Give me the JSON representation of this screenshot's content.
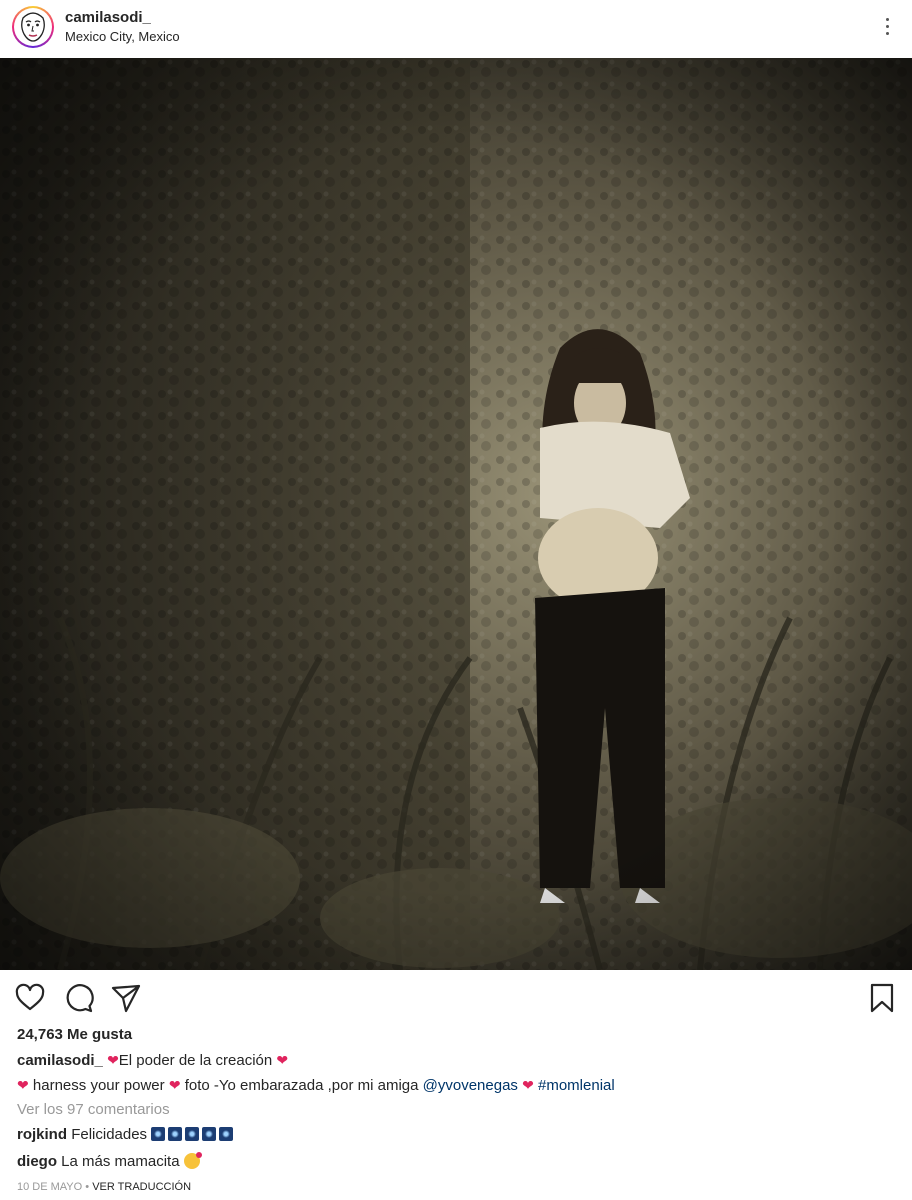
{
  "post": {
    "username": "camilasodi_",
    "location": "Mexico City, Mexico",
    "likes": "24,763 Me gusta",
    "caption": {
      "line1": "El poder de la creación",
      "line2_a": "harness your power",
      "line2_b": "foto -Yo embarazada ,por mi amiga",
      "mention": "@yvovenegas",
      "hashtag": "#momlenial",
      "heart": "❤"
    },
    "view_comments": "Ver los 97 comentarios",
    "comments": [
      {
        "user": "rojkind",
        "text": "Felicidades"
      },
      {
        "user": "diego",
        "text": "La más mamacita"
      }
    ],
    "date": "10 DE MAYO",
    "separator": "•",
    "translate": "VER TRADUCCIÓN"
  },
  "icons": {
    "more": "more-options-icon",
    "like": "heart-icon",
    "comment": "comment-icon",
    "share": "share-icon",
    "save": "bookmark-icon"
  },
  "colors": {
    "link": "#003569",
    "heart": "#e0245e",
    "muted": "#999999"
  }
}
